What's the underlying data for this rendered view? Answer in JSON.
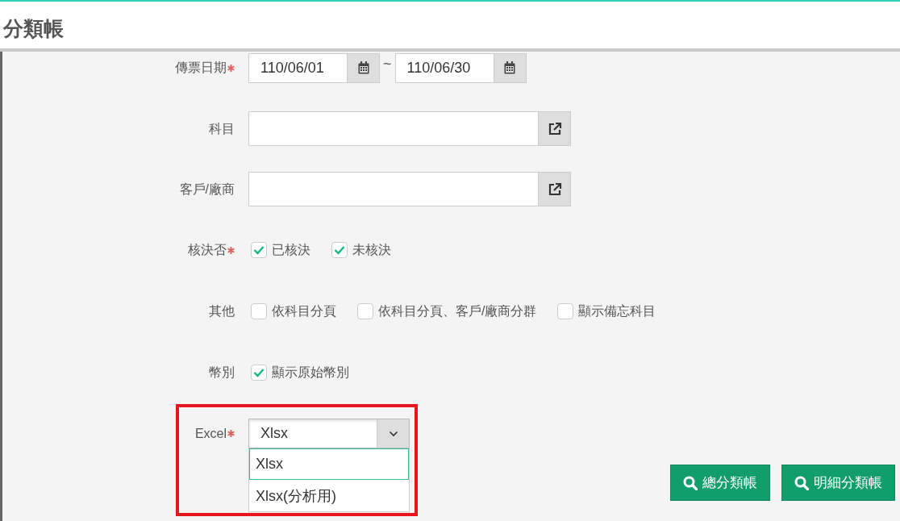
{
  "header": {
    "title": "分類帳"
  },
  "form": {
    "rows": [
      {
        "kind": "daterange",
        "label": "傳票日期",
        "required": true,
        "from": "110/06/01",
        "separator": "~",
        "to": "110/06/30"
      },
      {
        "kind": "picker",
        "label": "科目",
        "required": false
      },
      {
        "kind": "picker",
        "label": "客戶/廠商",
        "required": false
      },
      {
        "kind": "checks",
        "label": "核決否",
        "required": true,
        "options": [
          {
            "label": "已核決",
            "checked": true
          },
          {
            "label": "未核決",
            "checked": true
          }
        ]
      },
      {
        "kind": "checks",
        "label": "其他",
        "required": false,
        "options": [
          {
            "label": "依科目分頁",
            "checked": false
          },
          {
            "label": "依科目分頁、客戶/廠商分群",
            "checked": false
          },
          {
            "label": "顯示備忘科目",
            "checked": false
          }
        ]
      },
      {
        "kind": "checks",
        "label": "幣別",
        "required": false,
        "options": [
          {
            "label": "顯示原始幣別",
            "checked": true
          }
        ]
      },
      {
        "kind": "select",
        "label": "Excel",
        "required": true,
        "value": "Xlsx",
        "expanded": true,
        "highlighted": true,
        "options": [
          {
            "label": "Xlsx",
            "selected": true
          },
          {
            "label": "Xlsx(分析用)",
            "selected": false
          }
        ]
      }
    ]
  },
  "buttons": [
    {
      "label": "總分類帳"
    },
    {
      "label": "明細分類帳"
    }
  ]
}
